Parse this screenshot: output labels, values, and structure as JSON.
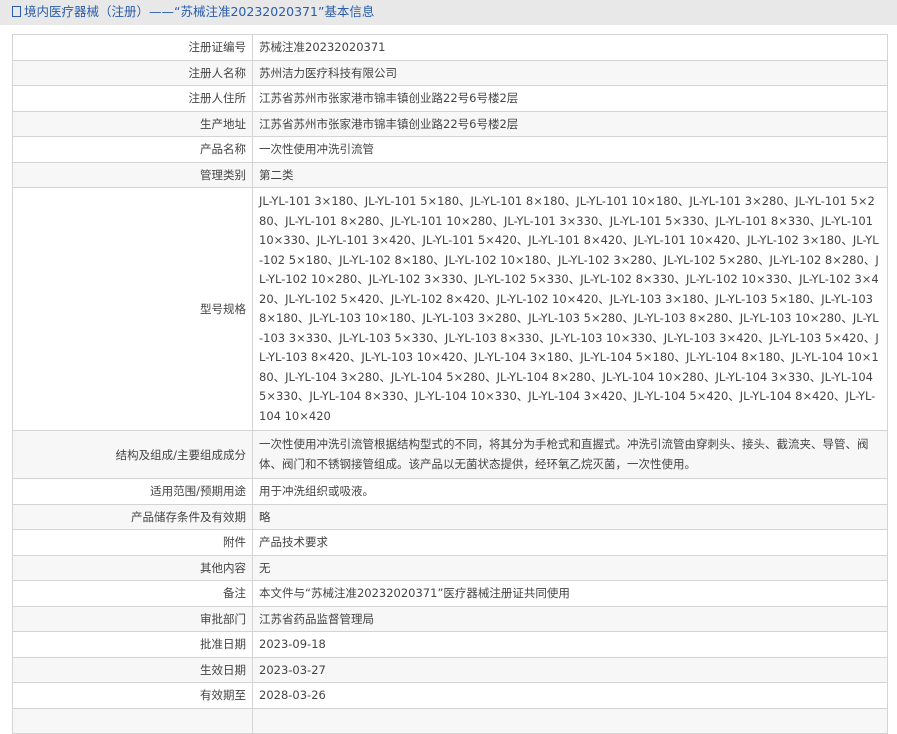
{
  "header": {
    "title": "境内医疗器械（注册）——“苏械注准20232020371”基本信息",
    "icon": "document-icon"
  },
  "rows": [
    {
      "label": "注册证编号",
      "value": "苏械注准20232020371"
    },
    {
      "label": "注册人名称",
      "value": "苏州洁力医疗科技有限公司"
    },
    {
      "label": "注册人住所",
      "value": "江苏省苏州市张家港市锦丰镇创业路22号6号楼2层"
    },
    {
      "label": "生产地址",
      "value": "江苏省苏州市张家港市锦丰镇创业路22号6号楼2层"
    },
    {
      "label": "产品名称",
      "value": "一次性使用冲洗引流管"
    },
    {
      "label": "管理类别",
      "value": "第二类"
    },
    {
      "label": "型号规格",
      "value": "JL-YL-101 3×180、JL-YL-101 5×180、JL-YL-101 8×180、JL-YL-101 10×180、JL-YL-101 3×280、JL-YL-101 5×280、JL-YL-101 8×280、JL-YL-101 10×280、JL-YL-101 3×330、JL-YL-101 5×330、JL-YL-101 8×330、JL-YL-101 10×330、JL-YL-101 3×420、JL-YL-101 5×420、JL-YL-101 8×420、JL-YL-101 10×420、JL-YL-102 3×180、JL-YL-102 5×180、JL-YL-102 8×180、JL-YL-102 10×180、JL-YL-102 3×280、JL-YL-102 5×280、JL-YL-102 8×280、JL-YL-102 10×280、JL-YL-102 3×330、JL-YL-102 5×330、JL-YL-102 8×330、JL-YL-102 10×330、JL-YL-102 3×420、JL-YL-102 5×420、JL-YL-102 8×420、JL-YL-102 10×420、JL-YL-103 3×180、JL-YL-103 5×180、JL-YL-103 8×180、JL-YL-103 10×180、JL-YL-103 3×280、JL-YL-103 5×280、JL-YL-103 8×280、JL-YL-103 10×280、JL-YL-103 3×330、JL-YL-103 5×330、JL-YL-103 8×330、JL-YL-103 10×330、JL-YL-103 3×420、JL-YL-103 5×420、JL-YL-103 8×420、JL-YL-103 10×420、JL-YL-104 3×180、JL-YL-104 5×180、JL-YL-104 8×180、JL-YL-104 10×180、JL-YL-104 3×280、JL-YL-104 5×280、JL-YL-104 8×280、JL-YL-104 10×280、JL-YL-104 3×330、JL-YL-104 5×330、JL-YL-104 8×330、JL-YL-104 10×330、JL-YL-104 3×420、JL-YL-104 5×420、JL-YL-104 8×420、JL-YL-104 10×420"
    },
    {
      "label": "结构及组成/主要组成成分",
      "value": "一次性使用冲洗引流管根据结构型式的不同，将其分为手枪式和直握式。冲洗引流管由穿刺头、接头、截流夹、导管、阀体、阀门和不锈钢接管组成。该产品以无菌状态提供，经环氧乙烷灭菌，一次性使用。"
    },
    {
      "label": "适用范围/预期用途",
      "value": "用于冲洗组织或吸液。"
    },
    {
      "label": "产品储存条件及有效期",
      "value": "略"
    },
    {
      "label": "附件",
      "value": "产品技术要求"
    },
    {
      "label": "其他内容",
      "value": "无"
    },
    {
      "label": "备注",
      "value": "本文件与“苏械注准20232020371”医疗器械注册证共同使用"
    },
    {
      "label": "审批部门",
      "value": "江苏省药品监督管理局"
    },
    {
      "label": "批准日期",
      "value": "2023-09-18"
    },
    {
      "label": "生效日期",
      "value": "2023-03-27"
    },
    {
      "label": "有效期至",
      "value": "2028-03-26"
    },
    {
      "label": "",
      "value": ""
    }
  ]
}
